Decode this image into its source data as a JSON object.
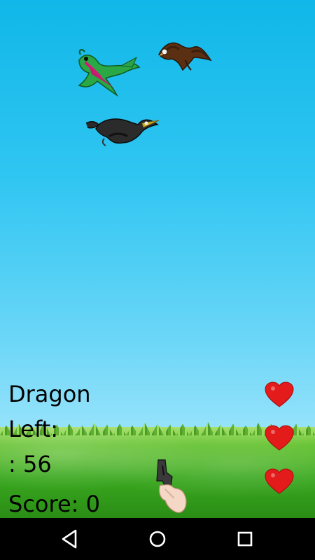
{
  "hud": {
    "line1": "Dragon",
    "line2": "Left:",
    "line3": ": 56",
    "score": "Score: 0"
  },
  "hearts": {
    "count": 3,
    "color": "#e31b1b"
  },
  "colors": {
    "sky_top": "#10b7e8",
    "grass": "#3aa81f",
    "nav_bg": "#000000"
  },
  "nav": {
    "back_icon": "triangle-back-icon",
    "home_icon": "circle-home-icon",
    "recents_icon": "square-recents-icon"
  }
}
